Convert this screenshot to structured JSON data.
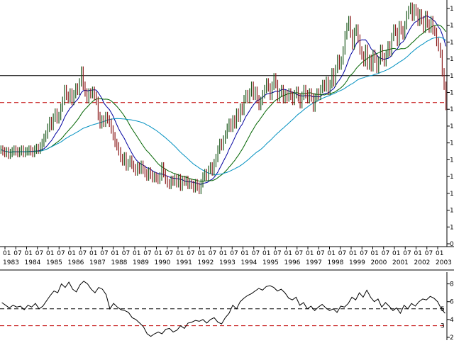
{
  "chart_data": [
    {
      "type": "candlestick",
      "panel": "price",
      "title": "",
      "ylim": [
        0,
        14.5
      ],
      "right_axis_ticks": [
        {
          "value": 0,
          "label": "0"
        },
        {
          "value": 1,
          "label": "1"
        },
        {
          "value": 2,
          "label": "1"
        },
        {
          "value": 3,
          "label": "1"
        },
        {
          "value": 4,
          "label": "1"
        },
        {
          "value": 5,
          "label": "1"
        },
        {
          "value": 6,
          "label": "1"
        },
        {
          "value": 7,
          "label": "1"
        },
        {
          "value": 8,
          "label": "1"
        },
        {
          "value": 9,
          "label": "1"
        },
        {
          "value": 10,
          "label": "1"
        },
        {
          "value": 11,
          "label": "1"
        },
        {
          "value": 12,
          "label": "1"
        },
        {
          "value": 13,
          "label": "1"
        },
        {
          "value": 14,
          "label": "1"
        }
      ],
      "horizontal_lines": [
        {
          "value": 10,
          "style": "solid",
          "color": "#000000"
        },
        {
          "value": 8.4,
          "style": "dashed",
          "color": "#c00000"
        }
      ],
      "x_tick_months": [
        "01",
        "07",
        "01",
        "07",
        "01",
        "07",
        "01",
        "07",
        "01",
        "07",
        "01",
        "07",
        "01",
        "07",
        "01",
        "07",
        "01",
        "07",
        "01",
        "07",
        "01",
        "07",
        "01",
        "07",
        "01",
        "07",
        "01",
        "07",
        "01",
        "07",
        "01",
        "07",
        "01",
        "07",
        "01",
        "07",
        "01",
        "07",
        "01",
        "07",
        "01"
      ],
      "x_tick_years": [
        "1983",
        "1984",
        "1985",
        "1986",
        "1987",
        "1988",
        "1989",
        "1990",
        "1991",
        "1992",
        "1993",
        "1994",
        "1995",
        "1996",
        "1997",
        "1998",
        "1999",
        "2000",
        "2001",
        "2002",
        "2003"
      ],
      "monthly_close": [
        5.6,
        5.5,
        5.4,
        5.5,
        5.3,
        5.4,
        5.5,
        5.6,
        5.5,
        5.4,
        5.5,
        5.6,
        5.4,
        5.5,
        5.5,
        5.6,
        5.5,
        5.4,
        5.6,
        5.7,
        5.6,
        5.8,
        6.0,
        6.3,
        6.5,
        6.9,
        7.3,
        7.0,
        7.5,
        7.8,
        7.4,
        7.6,
        8.1,
        8.5,
        9.2,
        8.8,
        8.6,
        9.0,
        8.5,
        8.9,
        9.3,
        9.1,
        9.6,
        10.3,
        9.4,
        9.0,
        8.6,
        9.0,
        8.9,
        9.1,
        8.8,
        8.5,
        7.6,
        7.1,
        7.4,
        7.2,
        7.6,
        7.4,
        7.2,
        6.8,
        6.4,
        6.0,
        5.8,
        5.5,
        5.1,
        4.9,
        5.2,
        4.6,
        4.8,
        5.0,
        4.7,
        4.5,
        4.3,
        4.6,
        4.4,
        4.7,
        4.4,
        4.2,
        4.0,
        4.3,
        4.1,
        3.9,
        4.0,
        3.9,
        3.8,
        4.0,
        4.6,
        4.2,
        3.8,
        3.6,
        3.5,
        3.8,
        3.7,
        3.9,
        3.6,
        3.9,
        3.4,
        3.8,
        3.7,
        3.8,
        3.5,
        3.6,
        3.5,
        3.3,
        3.6,
        3.4,
        3.2,
        3.6,
        4.0,
        4.2,
        4.0,
        4.4,
        4.6,
        4.3,
        4.8,
        5.1,
        5.6,
        6.0,
        5.8,
        6.2,
        6.5,
        6.9,
        7.2,
        6.9,
        7.4,
        7.1,
        7.8,
        7.5,
        8.1,
        7.9,
        8.6,
        8.9,
        8.6,
        9.0,
        9.4,
        8.8,
        9.1,
        8.6,
        8.2,
        8.5,
        8.9,
        9.2,
        9.6,
        9.3,
        8.8,
        9.4,
        9.9,
        9.5,
        8.7,
        9.0,
        9.2,
        8.6,
        8.9,
        8.7,
        9.0,
        8.8,
        8.5,
        8.9,
        9.1,
        8.7,
        8.3,
        8.8,
        9.2,
        8.9,
        8.6,
        9.0,
        8.7,
        8.1,
        8.7,
        9.0,
        8.8,
        9.2,
        9.5,
        9.3,
        9.7,
        9.1,
        9.5,
        10.2,
        9.6,
        10.4,
        11.0,
        10.6,
        10.9,
        11.5,
        12.4,
        12.9,
        13.3,
        12.5,
        11.8,
        12.6,
        12.8,
        12.2,
        11.5,
        11.2,
        10.8,
        11.6,
        10.6,
        11.0,
        10.5,
        11.3,
        11.0,
        10.4,
        10.9,
        11.6,
        11.1,
        10.8,
        11.3,
        11.8,
        11.4,
        12.3,
        12.8,
        12.6,
        12.0,
        13.0,
        12.7,
        12.4,
        13.0,
        13.6,
        13.9,
        14.1,
        13.5,
        14.0,
        13.8,
        13.2,
        13.7,
        13.3,
        12.8,
        13.6,
        13.1,
        12.8,
        13.3,
        12.7,
        12.6,
        12.0,
        11.7,
        11.3,
        10.2,
        9.4,
        8.2
      ],
      "moving_averages": [
        {
          "window": 12,
          "color": "#0000a0"
        },
        {
          "window": 26,
          "color": "#006400"
        },
        {
          "window": 52,
          "color": "#0090c0"
        }
      ]
    },
    {
      "type": "line",
      "panel": "oscillator",
      "ylim": [
        2,
        9
      ],
      "right_axis_ticks": [
        {
          "value": 2,
          "label": "2"
        },
        {
          "value": 4,
          "label": "4"
        },
        {
          "value": 6,
          "label": "6"
        },
        {
          "value": 8,
          "label": "8"
        }
      ],
      "horizontal_lines": [
        {
          "value": 5.2,
          "style": "dashed",
          "color": "#000000"
        },
        {
          "value": 3.3,
          "style": "dashed",
          "color": "#c00000"
        }
      ],
      "right_labels": [
        "8",
        "6",
        "5",
        "4",
        "3",
        "2"
      ],
      "values": [
        5.9,
        5.6,
        5.3,
        5.6,
        5.4,
        5.5,
        5.1,
        5.6,
        5.4,
        5.8,
        5.2,
        5.5,
        6.1,
        6.7,
        7.2,
        7.0,
        8.0,
        7.6,
        8.2,
        7.4,
        7.1,
        7.9,
        8.3,
        8.0,
        7.4,
        7.0,
        7.6,
        7.4,
        6.8,
        5.2,
        5.8,
        5.4,
        5.1,
        5.0,
        4.8,
        4.2,
        4.0,
        3.6,
        3.2,
        2.4,
        2.1,
        2.4,
        2.6,
        2.4,
        2.9,
        3.0,
        2.6,
        2.8,
        3.3,
        3.0,
        3.6,
        3.7,
        3.9,
        3.8,
        4.0,
        3.6,
        4.0,
        4.2,
        3.7,
        3.5,
        4.2,
        4.7,
        5.6,
        5.2,
        6.0,
        6.4,
        6.7,
        6.9,
        7.2,
        7.5,
        7.3,
        7.7,
        7.8,
        7.6,
        7.2,
        7.4,
        7.0,
        6.4,
        6.2,
        6.5,
        5.6,
        5.9,
        5.2,
        5.5,
        5.0,
        5.4,
        5.7,
        5.3,
        5.0,
        5.2,
        4.8,
        5.5,
        5.4,
        5.8,
        6.5,
        6.2,
        7.0,
        6.5,
        7.3,
        6.5,
        6.0,
        6.3,
        5.4,
        5.9,
        5.5,
        5.0,
        5.3,
        4.7,
        5.6,
        5.2,
        5.8,
        5.5,
        6.0,
        6.3,
        6.2,
        6.6,
        6.4,
        6.0,
        5.2,
        4.7
      ]
    }
  ]
}
